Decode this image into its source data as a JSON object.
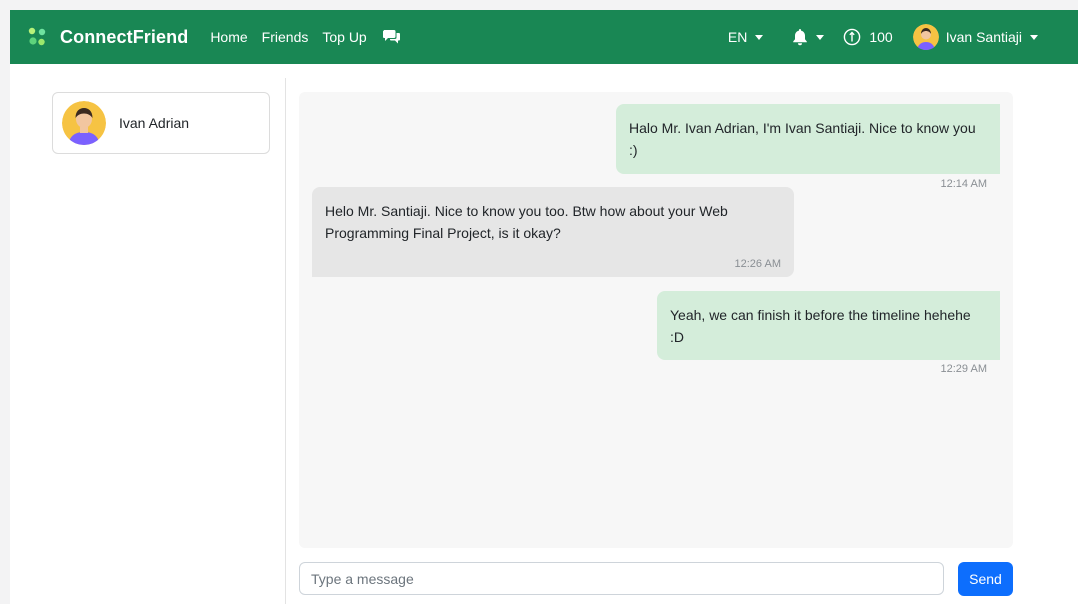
{
  "colors": {
    "navbar": "#198754",
    "bubble_me": "#d4edda",
    "bubble_them": "#e6e6e6",
    "send": "#0d6efd"
  },
  "navbar": {
    "brand": "ConnectFriend",
    "links": [
      "Home",
      "Friends",
      "Top Up"
    ],
    "chat_icon": "chat-bubbles-icon",
    "language": "EN",
    "bell_icon": "bell-icon",
    "coin_icon": "coin-icon",
    "coins": "100",
    "user_name": "Ivan Santiaji"
  },
  "sidebar": {
    "friends": [
      {
        "name": "Ivan Adrian"
      }
    ]
  },
  "chat": {
    "messages": [
      {
        "from": "me",
        "text": "Halo Mr. Ivan Adrian, I'm Ivan Santiaji. Nice to know you :)",
        "time": "12:14 AM"
      },
      {
        "from": "them",
        "text": "Helo Mr. Santiaji. Nice to know you too. Btw how about your Web Programming Final Project, is it okay?",
        "time": "12:26 AM"
      },
      {
        "from": "me",
        "text": "Yeah, we can finish it before the timeline hehehe :D",
        "time": "12:29 AM"
      }
    ]
  },
  "composer": {
    "placeholder": "Type a message",
    "value": "",
    "send_label": "Send"
  }
}
